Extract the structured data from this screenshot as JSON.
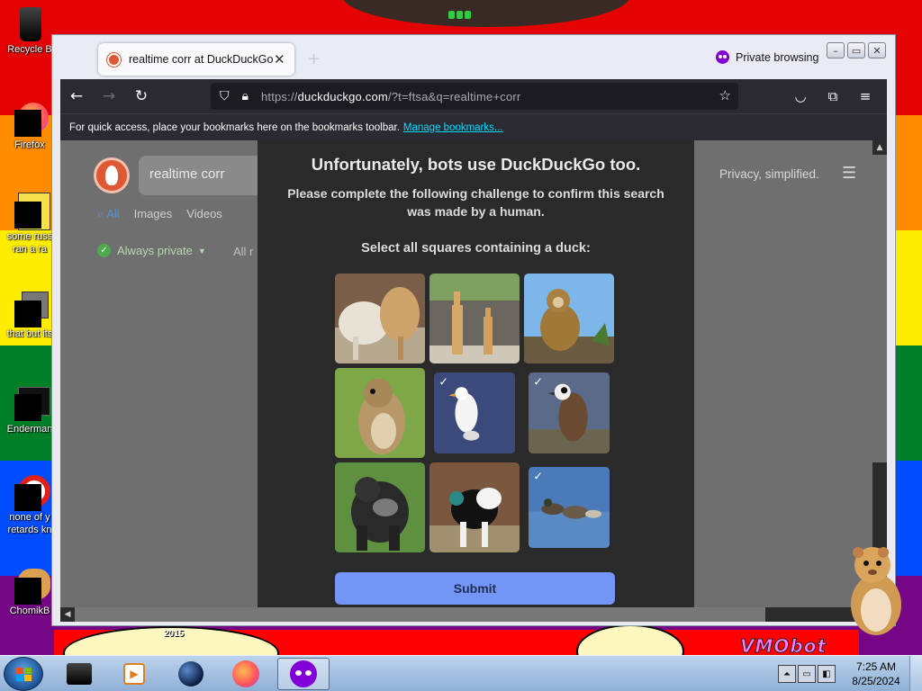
{
  "desktop": {
    "icons": [
      {
        "label": "Recycle Bin",
        "display": "Recycle B",
        "icon": "recycle-bin-icon"
      },
      {
        "label": "Firefox",
        "display": "Firefox",
        "icon": "firefox-icon"
      },
      {
        "label": "some russ... ran a ra...",
        "display": "some russ",
        "display2": "ran a ra",
        "icon": "document-icon"
      },
      {
        "label": "that but its",
        "display": "that but its",
        "icon": "folder-icon"
      },
      {
        "label": "Enderman",
        "display": "Enderman",
        "icon": "program-icon"
      },
      {
        "label": "none of y retards kn",
        "display": "none of y",
        "display2": "retards kn",
        "icon": "opera-icon"
      },
      {
        "label": "ChomikB",
        "display": "ChomikB",
        "icon": "hamster-icon"
      }
    ],
    "wallpaper_text": {
      "year": "2015",
      "vm": "VMObot"
    }
  },
  "browser": {
    "tab": {
      "title": "realtime corr at DuckDuckGo",
      "close": "✕"
    },
    "new_tab": "+",
    "private_label": "Private browsing",
    "window_buttons": {
      "minimize": "–",
      "maximize": "▭",
      "close": "✕"
    },
    "nav": {
      "back": "←",
      "forward": "→",
      "reload": "↻"
    },
    "url": {
      "host": "duckduckgo.com",
      "prefix": "https://",
      "rest": "/?t=ftsa&q=realtime+corr"
    },
    "bookmarks_text": "For quick access, place your bookmarks here on the bookmarks toolbar.",
    "bookmarks_link": "Manage bookmarks..."
  },
  "ddg": {
    "search_value": "realtime corr",
    "tabs": [
      "All",
      "Images",
      "Videos"
    ],
    "always_private": "Always private",
    "all_regions": "All r",
    "tagline": "Privacy, simplified."
  },
  "challenge": {
    "title": "Unfortunately, bots use DuckDuckGo too.",
    "subtitle": "Please complete the following challenge to confirm this search was made by a human.",
    "prompt": "Select all squares containing a duck:",
    "submit": "Submit",
    "tiles": [
      {
        "subject": "goat and sheep",
        "selected": false
      },
      {
        "subject": "giraffes",
        "selected": false
      },
      {
        "subject": "monkey",
        "selected": false
      },
      {
        "subject": "squirrel",
        "selected": false
      },
      {
        "subject": "white duck",
        "selected": true
      },
      {
        "subject": "duck",
        "selected": true
      },
      {
        "subject": "gorilla",
        "selected": false
      },
      {
        "subject": "dog",
        "selected": false
      },
      {
        "subject": "ducks on water",
        "selected": true
      }
    ]
  },
  "taskbar": {
    "clock_time": "7:25 AM",
    "clock_date": "8/25/2024"
  }
}
